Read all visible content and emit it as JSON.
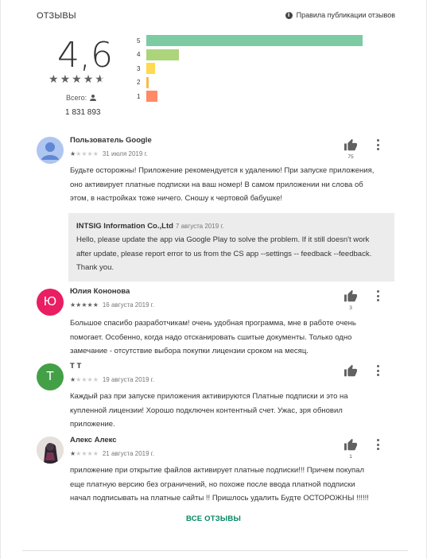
{
  "header": {
    "title": "ОТЗЫВЫ",
    "policy_link": "Правила публикации отзывов",
    "info_icon": "i"
  },
  "summary": {
    "rating": "4,6",
    "stars": [
      "★",
      "★",
      "★",
      "★",
      "★"
    ],
    "stars_value": 4.6,
    "total_label": "Всего:",
    "total_count": "1 831 893"
  },
  "histogram": [
    {
      "label": "5",
      "fraction": 1.0,
      "color": "#7ccba2"
    },
    {
      "label": "4",
      "fraction": 0.15,
      "color": "#acd57b"
    },
    {
      "label": "3",
      "fraction": 0.04,
      "color": "#ffd94f"
    },
    {
      "label": "2",
      "fraction": 0.01,
      "color": "#ffb74d"
    },
    {
      "label": "1",
      "fraction": 0.05,
      "color": "#ff8a65"
    }
  ],
  "reviews": [
    {
      "author": "Пользователь Google",
      "avatar_initial": "",
      "avatar_color": "#aec6f0",
      "rating": 1,
      "date": "31 июля 2019 г.",
      "likes": "75",
      "lines": [
        "Будьте осторожны! Приложение рекомендуется к удалению! При запуске приложения,",
        "оно активирует платные подписки на ваш номер! В самом приложении ни слова об",
        "этом, в настройках тоже ничего. Сношу к чертовой бабушке!"
      ]
    },
    {
      "author": "Юлия Кононова",
      "avatar_initial": "Ю",
      "avatar_color": "#e91e63",
      "rating": 5,
      "date": "16 августа 2019 г.",
      "likes": "3",
      "lines": [
        "Большое спасибо разработчикам! очень удобная программа, мне в работе очень",
        "помогает. Особенно, когда надо отсканировать сшитые документы. Только одно",
        "замечание - отсутствие выбора покупки лицензии сроком на месяц."
      ]
    },
    {
      "author": "Т Т",
      "avatar_initial": "Т",
      "avatar_color": "#43a047",
      "rating": 1,
      "date": "19 августа 2019 г.",
      "likes": "",
      "lines": [
        "Каждый раз при запуске приложения активируются Платные подписки и это на",
        "купленной лицензии! Хорошо подключен контентный счет. Ужас, зря обновил",
        "приложение."
      ]
    },
    {
      "author": "Алекс Алекс",
      "avatar_initial": "",
      "avatar_color": "#3a3a3a",
      "rating": 1,
      "date": "21 августа 2019 г.",
      "likes": "1",
      "lines": [
        "приложение при открытие файлов активирует платные подписки!!! Причем покупал",
        "еще платную версию без ограничений, но похоже после ввода платной подписки",
        "начал подписывать на платные сайты !! Пришлось удалить Будте ОСТОРОЖНЫ !!!!!!"
      ]
    }
  ],
  "reply": {
    "author": "INTSIG Information Co.,Ltd",
    "date": "7 августа 2019 г.",
    "lines": [
      "Hello, please update the app via Google Play to solve the problem. If it still doesn't work",
      "after update, please report error to us from the CS app --settings -- feedback --feedback.",
      "Thank you."
    ]
  },
  "all_reviews_label": "ВСЕ ОТЗЫВЫ",
  "colors": {
    "star_filled": "#616161",
    "star_empty": "#cccccc",
    "small_star_filled": "#616161",
    "accent": "#01875f"
  },
  "icons": {
    "info": "info-icon",
    "person": "person-icon",
    "thumb": "thumbs-up-icon",
    "more": "more-vert-icon"
  }
}
